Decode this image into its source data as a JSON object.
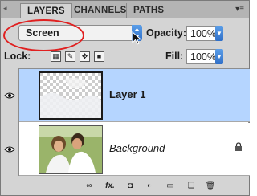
{
  "tabs": [
    "LAYERS",
    "CHANNELS",
    "PATHS"
  ],
  "blend_mode": "Screen",
  "opacity": {
    "label": "Opacity:",
    "value": "100%"
  },
  "lock": {
    "label": "Lock:"
  },
  "fill": {
    "label": "Fill:",
    "value": "100%"
  },
  "layers": [
    {
      "name": "Layer 1",
      "selected": true,
      "visible": true
    },
    {
      "name": "Background",
      "selected": false,
      "visible": true,
      "locked": true
    }
  ],
  "toolbar": {
    "fx_label": "fx."
  },
  "colors": {
    "selection": "#b5d5ff",
    "accent": "#2f6fc8",
    "highlight": "#e02020"
  }
}
